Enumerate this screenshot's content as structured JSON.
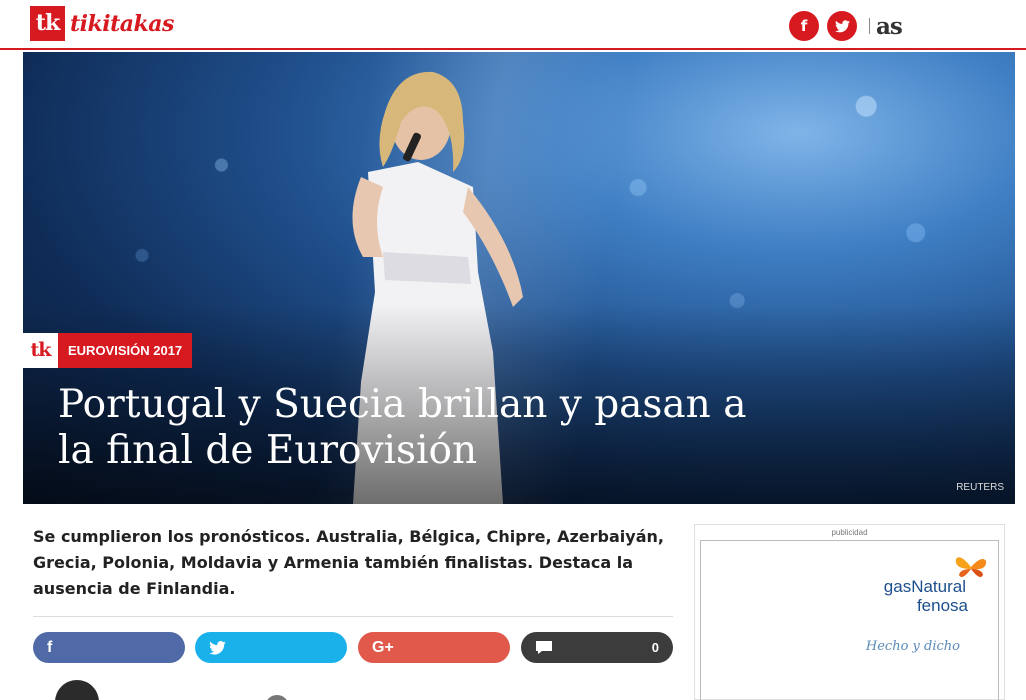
{
  "header": {
    "logo_mark": "tk",
    "logo_text": "tikitakas",
    "facebook_glyph": "f",
    "twitter_glyph": "t",
    "partner_logo": "as"
  },
  "hero": {
    "tag_mark": "tk",
    "tag_label": "EUROVISIÓN 2017",
    "headline": "Portugal y Suecia brillan y pasan a la final de Eurovisión",
    "photo_credit": "REUTERS"
  },
  "article": {
    "lead": "Se cumplieron los pronósticos. Australia, Bélgica, Chipre, Azerbaiyán, Grecia, Polonia, Moldavia y Armenia también finalistas. Destaca la ausencia de Finlandia."
  },
  "share": {
    "facebook": "f",
    "twitter": "t",
    "googleplus": "G+",
    "comments_count": "0"
  },
  "ad": {
    "label": "publicidad",
    "brand_line1": "gasNatural",
    "brand_line2": "fenosa",
    "slogan": "Hecho y dicho"
  },
  "colors": {
    "brand_red": "#d71920",
    "facebook": "#4f6aa6",
    "twitter": "#1ab0ea",
    "googleplus": "#e0594a",
    "comments": "#3c3c3c"
  }
}
